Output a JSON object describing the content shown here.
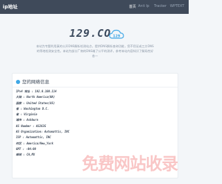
{
  "header": {
    "brand": "ip地址",
    "nav": [
      "首页",
      "Anti Ip",
      "Tracker",
      "WPTEXT"
    ]
  },
  "logo": {
    "text": "129.CO",
    "badge": "129"
  },
  "description": "本站为专题利用真的公开DNS解析检测站点，提供DNS解析查询功能，您不用证或三方DNS的等地检测安全性。本站为部分厂商的DNS端了公平的测评，参考本站内容知识了解局性好各一",
  "card": {
    "title": "您的网络信息",
    "rows": [
      "IPv4 地址 : 192.0.100.114",
      "大陆 : North America(NA)",
      "国家 : United States(US)",
      "省 : Washington D.C.",
      "省 : Virginia",
      "城市 : Ashburn",
      "AS Number : AS2635",
      "AS Organization: Automattic, INC",
      "ISP : Automattic, INC",
      "时区 : America/New_York",
      "GMT : -04:00",
      "邮政 : CA,MX"
    ]
  },
  "watermark": "免费网站收录",
  "colors": {
    "topbar": "#3f4a5a",
    "accent": "#3fa7e6",
    "watermark": "#f8b4b4"
  }
}
